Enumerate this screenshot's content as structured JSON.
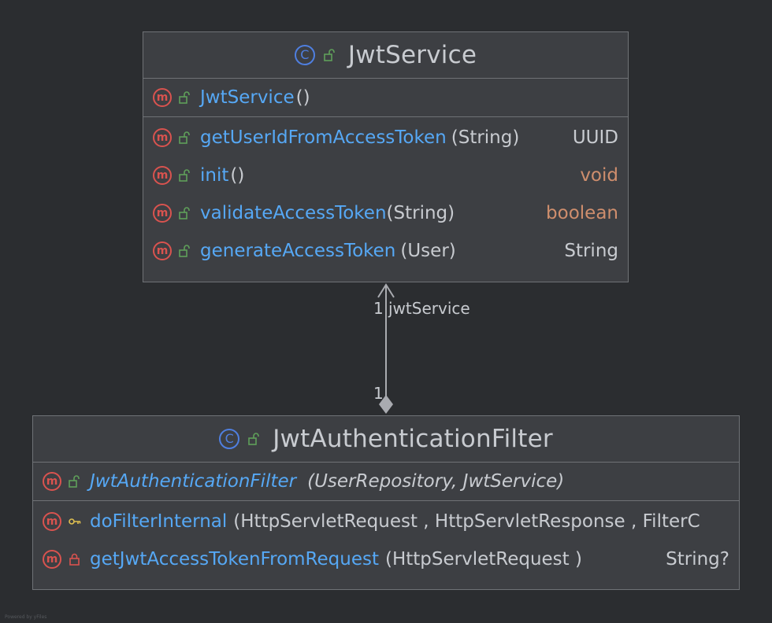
{
  "jwt_service": {
    "title": "JwtService",
    "constructor": {
      "name": "JwtService",
      "params": "()"
    },
    "methods": [
      {
        "name": "getUserIdFromAccessToken",
        "params": "(String)",
        "ret": "UUID"
      },
      {
        "name": "init",
        "params": "()",
        "ret": "void"
      },
      {
        "name": "validateAccessToken",
        "params": "(String)",
        "ret": "boolean"
      },
      {
        "name": "generateAccessToken",
        "params": "(User)",
        "ret": "String"
      }
    ]
  },
  "association": {
    "top_multiplicity": "1",
    "role": "jwtService",
    "bottom_multiplicity": "1"
  },
  "jwt_filter": {
    "title": "JwtAuthenticationFilter",
    "constructor": {
      "name": "JwtAuthenticationFilter",
      "params": "(UserRepository, JwtService)"
    },
    "methods": [
      {
        "name": "doFilterInternal",
        "params": "(HttpServletRequest , HttpServletResponse , FilterC",
        "ret": ""
      },
      {
        "name": "getJwtAccessTokenFromRequest",
        "params": "(HttpServletRequest )",
        "ret": "String?"
      }
    ]
  },
  "watermark": "Powered by yFiles",
  "colors": {
    "background": "#2b2d30",
    "box": "#3d3f43",
    "method_name": "#56a8f5",
    "keyword": "#cf8e6d",
    "method_icon": "#d9534f",
    "class_icon": "#4f7fe0",
    "public_lock": "#5fa05a",
    "protected_key": "#e0c050",
    "private_lock": "#d9534f"
  }
}
